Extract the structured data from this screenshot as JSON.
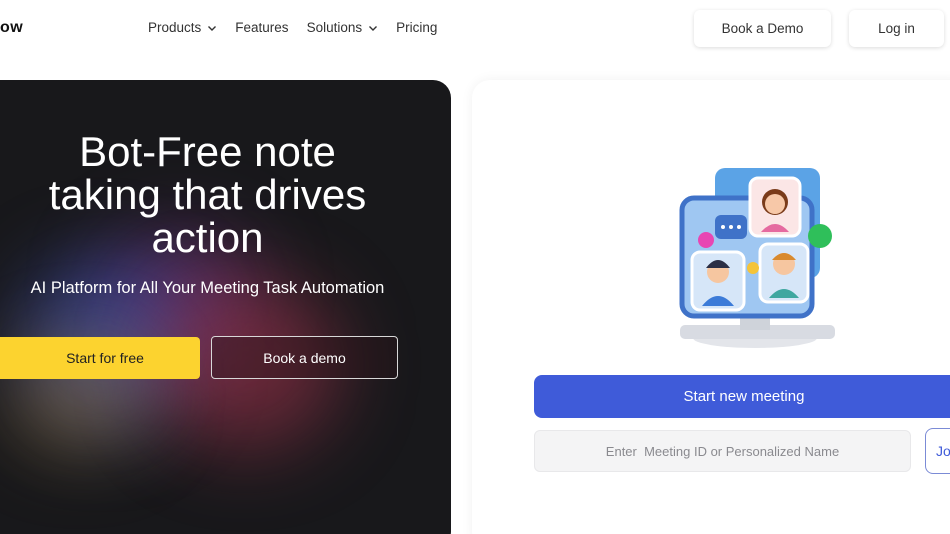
{
  "brand": {
    "logo_text": "ow"
  },
  "nav": {
    "items": [
      {
        "label": "Products",
        "has_dropdown": true
      },
      {
        "label": "Features",
        "has_dropdown": false
      },
      {
        "label": "Solutions",
        "has_dropdown": true
      },
      {
        "label": "Pricing",
        "has_dropdown": false
      }
    ],
    "book_demo_label": "Book a Demo",
    "login_label": "Log in"
  },
  "hero": {
    "title_lines": [
      "Bot-Free note",
      "taking that drives",
      "action"
    ],
    "subtitle": "AI Platform for All Your Meeting Task Automation",
    "primary_cta": "Start for free",
    "secondary_cta": "Book a demo"
  },
  "meeting": {
    "illustration": "video-call-monitor-icon",
    "start_label": "Start new meeting",
    "input_placeholder": "Enter  Meeting ID or Personalized Name",
    "input_value": "",
    "join_label": "Jo"
  },
  "colors": {
    "hero_bg": "#18181b",
    "accent_blue": "#3f5bd9",
    "accent_yellow": "#fcd32f"
  }
}
